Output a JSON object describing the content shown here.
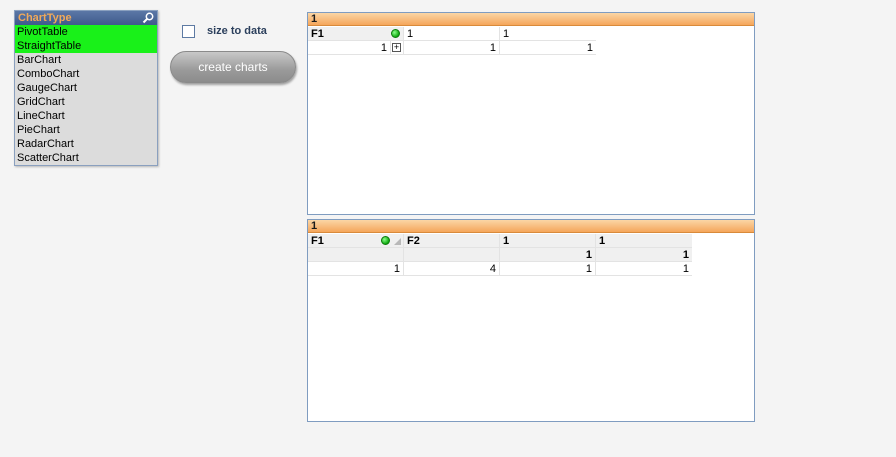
{
  "listbox": {
    "title": "ChartType",
    "items": [
      {
        "label": "PivotTable",
        "selected": true
      },
      {
        "label": "StraightTable",
        "selected": true
      },
      {
        "label": "BarChart",
        "selected": false
      },
      {
        "label": "ComboChart",
        "selected": false
      },
      {
        "label": "GaugeChart",
        "selected": false
      },
      {
        "label": "GridChart",
        "selected": false
      },
      {
        "label": "LineChart",
        "selected": false
      },
      {
        "label": "PieChart",
        "selected": false
      },
      {
        "label": "RadarChart",
        "selected": false
      },
      {
        "label": "ScatterChart",
        "selected": false
      }
    ]
  },
  "options": {
    "size_to_data_label": "size to data",
    "size_to_data_checked": false,
    "create_button_label": "create charts"
  },
  "pivot": {
    "title": "1",
    "header": {
      "dim": "F1",
      "col1": "1",
      "col2": "1"
    },
    "row": {
      "dim": "1",
      "col1": "1",
      "col2": "1"
    }
  },
  "straight": {
    "title": "1",
    "header": {
      "f1": "F1",
      "f2": "F2",
      "e1": "1",
      "e2": "1"
    },
    "totals": {
      "e1": "1",
      "e2": "1"
    },
    "row": {
      "f1": "1",
      "f2": "4",
      "e1": "1",
      "e2": "1"
    }
  },
  "colors": {
    "selected": "#19f119",
    "caption_orange": "#f5a65b",
    "listbox_header": "#3e5a8c"
  }
}
